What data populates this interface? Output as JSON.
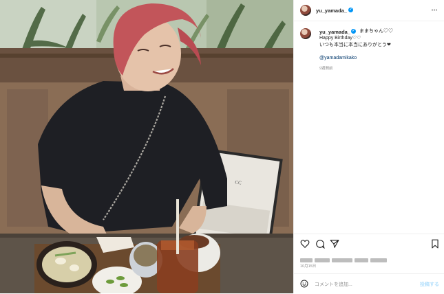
{
  "post": {
    "username": "yu_yamada_",
    "more_icon": "⋯",
    "caption_lines": [
      "ままちゃん♡♡",
      "Happy Birthday♡♡",
      "いつも本当に本当にありがとう❤︎"
    ],
    "mention": "@yamadamikako",
    "time_ago": "9週間前",
    "date": "10月15日"
  },
  "comment": {
    "placeholder": "コメントを追加...",
    "post_label": "投稿する"
  },
  "icons": {
    "verified": "✓"
  },
  "colors": {
    "verified": "#0095f6",
    "mention": "#00376b",
    "post_button": "#b2dffc"
  }
}
